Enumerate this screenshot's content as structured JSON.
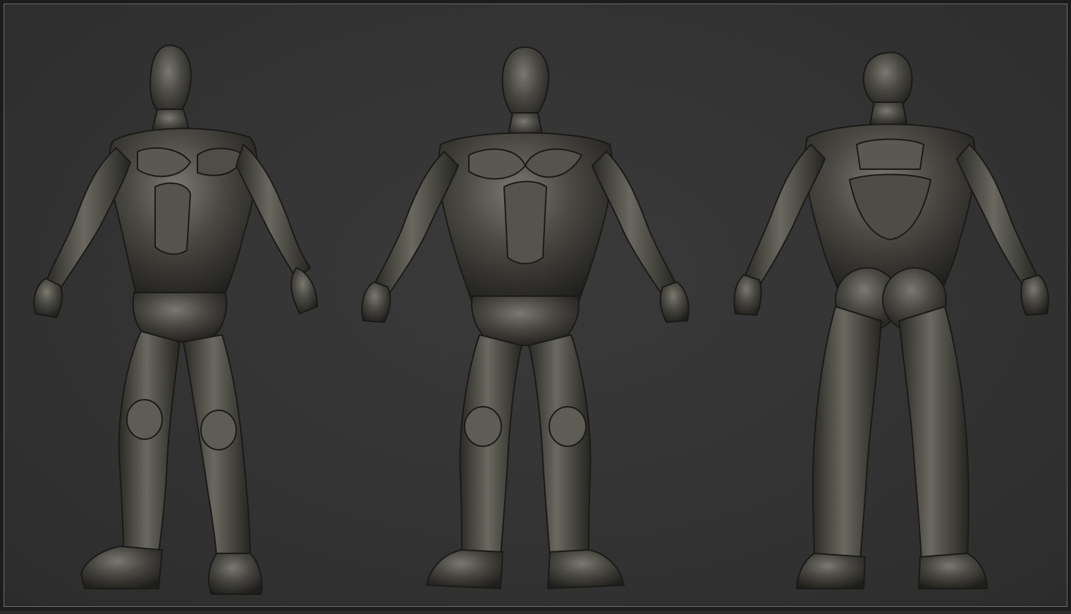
{
  "scene": {
    "background_color": "#333333",
    "frame_color": "#1c1c1c",
    "model_color": "#4a4943",
    "model_highlight": "#7a786f",
    "model_shadow": "#1e1e1b",
    "views": [
      {
        "id": "three-quarter",
        "icon": "figure-three-quarter-view"
      },
      {
        "id": "front",
        "icon": "figure-front-view"
      },
      {
        "id": "back",
        "icon": "figure-back-view"
      }
    ]
  }
}
